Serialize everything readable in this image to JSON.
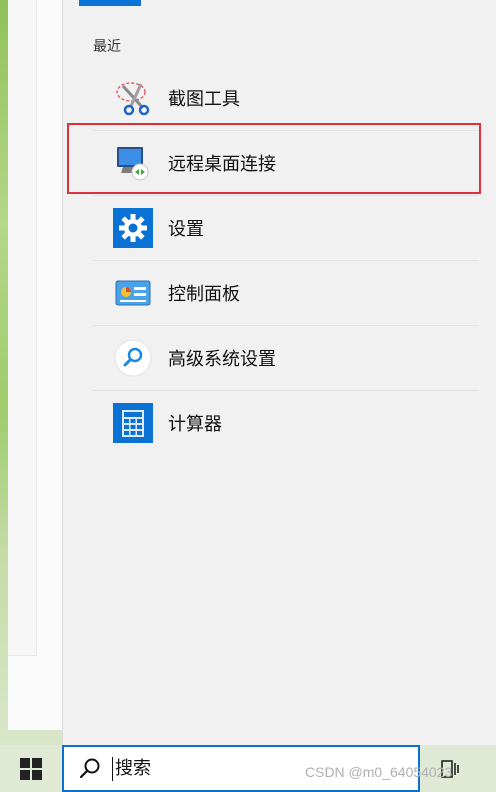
{
  "recent": {
    "title": "最近",
    "items": [
      {
        "label": "截图工具",
        "icon": "snipping-tool-icon"
      },
      {
        "label": "远程桌面连接",
        "icon": "remote-desktop-icon"
      },
      {
        "label": "设置",
        "icon": "settings-gear-icon"
      },
      {
        "label": "控制面板",
        "icon": "control-panel-icon"
      },
      {
        "label": "高级系统设置",
        "icon": "advanced-settings-search-icon"
      },
      {
        "label": "计算器",
        "icon": "calculator-icon"
      }
    ]
  },
  "taskbar": {
    "search_placeholder": "搜索",
    "start_icon": "windows-logo-icon",
    "taskview_icon": "task-view-icon"
  },
  "watermark": "CSDN @m0_64054023",
  "colors": {
    "accent": "#0a74d9",
    "highlight": "#e0303a"
  }
}
